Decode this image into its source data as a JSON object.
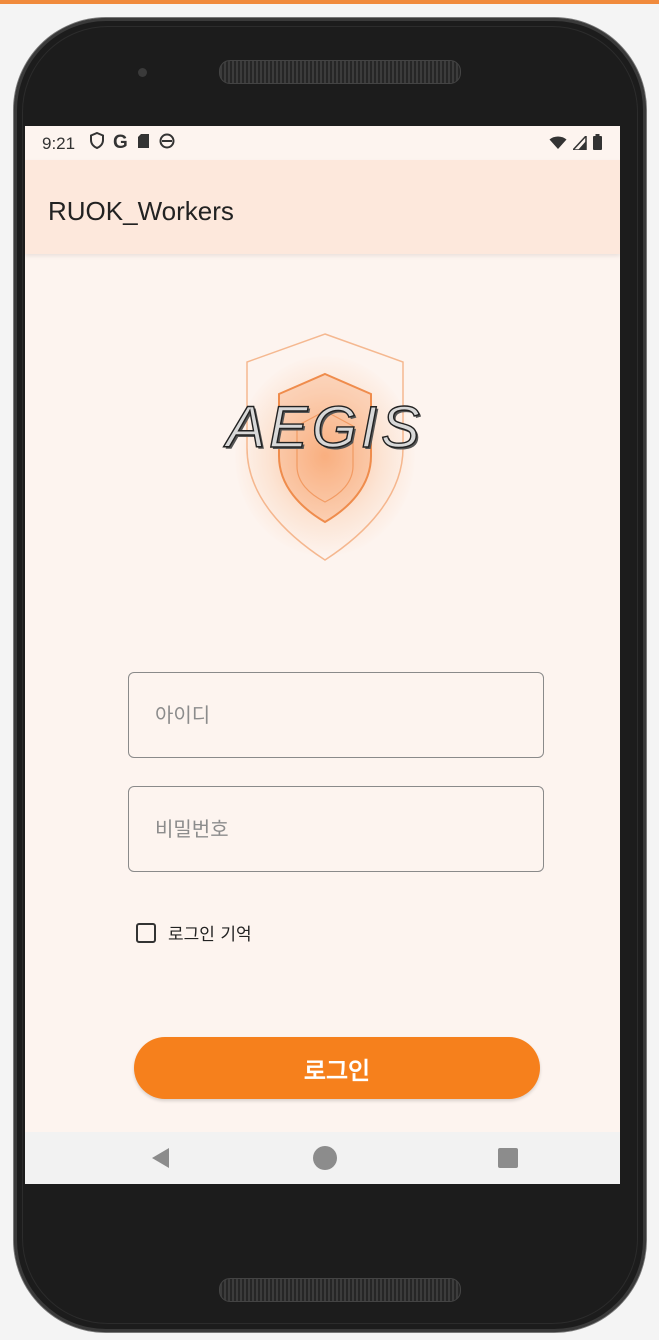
{
  "status_bar": {
    "time": "9:21",
    "left_icons": [
      "shield-outline-icon",
      "google-g-icon",
      "sd-card-icon",
      "android-icon"
    ],
    "right_icons": [
      "wifi-icon",
      "signal-icon",
      "battery-icon"
    ],
    "google_glyph": "G"
  },
  "app_bar": {
    "title": "RUOK_Workers"
  },
  "logo": {
    "text": "AEGIS"
  },
  "form": {
    "id_placeholder": "아이디",
    "password_placeholder": "비밀번호",
    "remember_label": "로그인 기억",
    "remember_checked": false,
    "login_label": "로그인"
  },
  "nav": {
    "icons": [
      "back-icon",
      "home-icon",
      "recent-apps-icon"
    ]
  },
  "colors": {
    "accent": "#f6801c",
    "app_bar_bg": "#fde8dc",
    "screen_bg": "#fdf4ef",
    "top_accent": "#f08a3c"
  }
}
